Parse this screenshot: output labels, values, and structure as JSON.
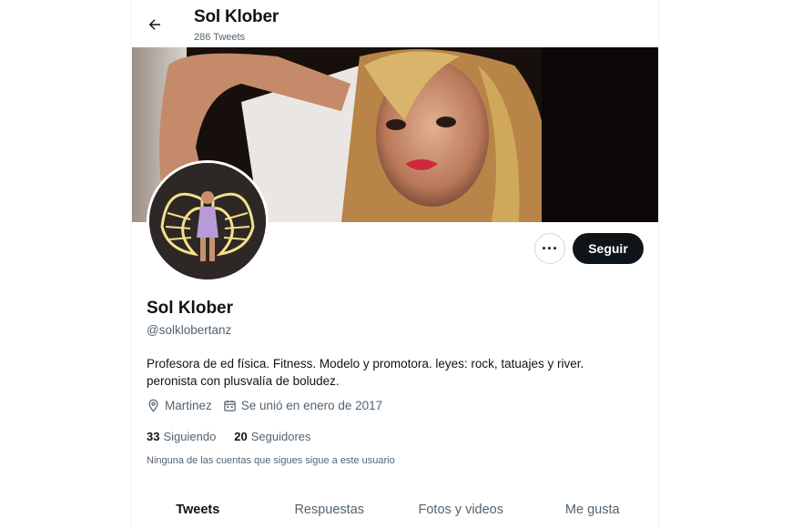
{
  "header": {
    "name": "Sol Klober",
    "tweet_count": "286 Tweets"
  },
  "profile": {
    "name": "Sol Klober",
    "handle": "@solklobertanz",
    "bio": "Profesora de ed física. Fitness. Modelo y promotora. leyes: rock, tatuajes y river. peronista con plusvalía de boludez.",
    "location": "Martinez",
    "joined": "Se unió en enero de 2017",
    "following_count": "33",
    "following_label": "Siguiendo",
    "followers_count": "20",
    "followers_label": "Seguidores",
    "mutual_note": "Ninguna de las cuentas que sigues sigue a este usuario"
  },
  "actions": {
    "more_label": "···",
    "follow_label": "Seguir"
  },
  "tabs": [
    {
      "label": "Tweets"
    },
    {
      "label": "Respuestas"
    },
    {
      "label": "Fotos y videos"
    },
    {
      "label": "Me gusta"
    }
  ],
  "colors": {
    "text": "#0f1419",
    "secondary": "#536471",
    "button": "#0f1419"
  },
  "icons": {
    "back": "arrow-left-icon",
    "location": "map-pin-icon",
    "calendar": "calendar-icon"
  }
}
